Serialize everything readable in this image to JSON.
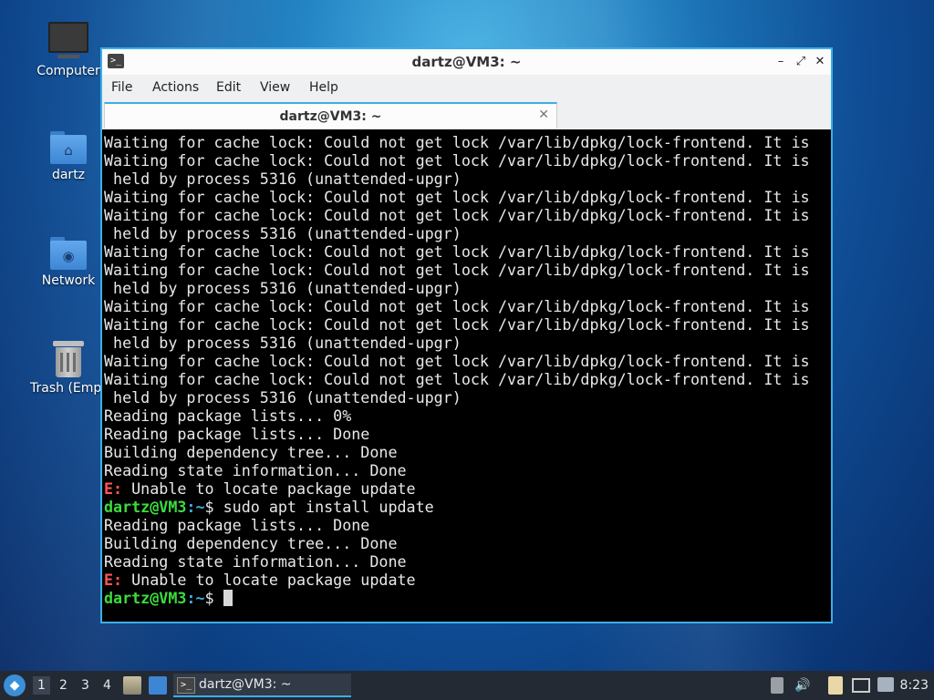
{
  "desktop": {
    "icons": [
      {
        "label": "Computer",
        "icon": "computer-icon"
      },
      {
        "label": "dartz",
        "icon": "home-folder-icon"
      },
      {
        "label": "Network",
        "icon": "network-folder-icon"
      },
      {
        "label": "Trash (Empty)",
        "icon": "trash-icon"
      }
    ]
  },
  "window": {
    "title": "dartz@VM3: ~",
    "menu": [
      "File",
      "Actions",
      "Edit",
      "View",
      "Help"
    ],
    "tab_label": "dartz@VM3: ~",
    "terminal": {
      "lines": [
        {
          "text": "Waiting for cache lock: Could not get lock /var/lib/dpkg/lock-frontend. It is"
        },
        {
          "text": "Waiting for cache lock: Could not get lock /var/lib/dpkg/lock-frontend. It is"
        },
        {
          "text": " held by process 5316 (unattended-upgr)"
        },
        {
          "text": "Waiting for cache lock: Could not get lock /var/lib/dpkg/lock-frontend. It is"
        },
        {
          "text": "Waiting for cache lock: Could not get lock /var/lib/dpkg/lock-frontend. It is"
        },
        {
          "text": " held by process 5316 (unattended-upgr)"
        },
        {
          "text": "Waiting for cache lock: Could not get lock /var/lib/dpkg/lock-frontend. It is"
        },
        {
          "text": "Waiting for cache lock: Could not get lock /var/lib/dpkg/lock-frontend. It is"
        },
        {
          "text": " held by process 5316 (unattended-upgr)"
        },
        {
          "text": "Waiting for cache lock: Could not get lock /var/lib/dpkg/lock-frontend. It is"
        },
        {
          "text": "Waiting for cache lock: Could not get lock /var/lib/dpkg/lock-frontend. It is"
        },
        {
          "text": " held by process 5316 (unattended-upgr)"
        },
        {
          "text": "Waiting for cache lock: Could not get lock /var/lib/dpkg/lock-frontend. It is"
        },
        {
          "text": "Waiting for cache lock: Could not get lock /var/lib/dpkg/lock-frontend. It is"
        },
        {
          "text": " held by process 5316 (unattended-upgr)"
        },
        {
          "text": "Reading package lists... 0%"
        },
        {
          "text": "Reading package lists... Done"
        },
        {
          "text": "Building dependency tree... Done"
        },
        {
          "text": "Reading state information... Done"
        },
        {
          "error_prefix": "E:",
          "text": " Unable to locate package update"
        },
        {
          "prompt_user": "dartz@VM3",
          "prompt_path": ":~",
          "prompt_sym": "$ ",
          "command": "sudo apt install update"
        },
        {
          "text": "Reading package lists... Done"
        },
        {
          "text": "Building dependency tree... Done"
        },
        {
          "text": "Reading state information... Done"
        },
        {
          "error_prefix": "E:",
          "text": " Unable to locate package update"
        },
        {
          "prompt_user": "dartz@VM3",
          "prompt_path": ":~",
          "prompt_sym": "$ ",
          "command": "",
          "cursor": true
        }
      ]
    }
  },
  "taskbar": {
    "workspaces": [
      "1",
      "2",
      "3",
      "4"
    ],
    "current_workspace": "1",
    "task_label": "dartz@VM3: ~",
    "clock": "8:23"
  },
  "colors": {
    "accent": "#3daee9",
    "error": "#ff5555",
    "prompt_user": "#3cdc3c",
    "terminal_bg": "#000000",
    "taskbar_bg": "#232a33"
  }
}
